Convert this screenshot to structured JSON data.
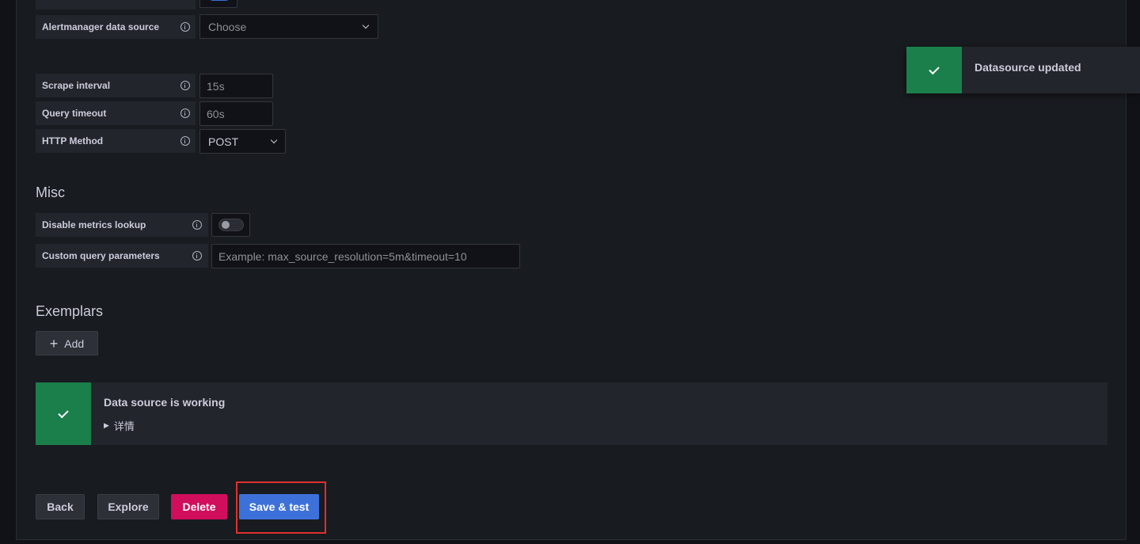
{
  "form": {
    "alertmanager": {
      "label": "Alertmanager data source",
      "placeholder": "Choose"
    },
    "scrape_interval": {
      "label": "Scrape interval",
      "placeholder": "15s"
    },
    "query_timeout": {
      "label": "Query timeout",
      "placeholder": "60s"
    },
    "http_method": {
      "label": "HTTP Method",
      "value": "POST"
    }
  },
  "misc": {
    "title": "Misc",
    "disable_metrics_lookup": {
      "label": "Disable metrics lookup",
      "enabled": false
    },
    "custom_query_params": {
      "label": "Custom query parameters",
      "placeholder": "Example: max_source_resolution=5m&timeout=10"
    }
  },
  "exemplars": {
    "title": "Exemplars",
    "add_label": "Add"
  },
  "status": {
    "title": "Data source is working",
    "details_label": "详情",
    "color": "#1a7f4b"
  },
  "toast": {
    "message": "Datasource updated"
  },
  "actions": {
    "back_label": "Back",
    "explore_label": "Explore",
    "delete_label": "Delete",
    "save_label": "Save & test"
  },
  "colors": {
    "primary": "#3d71d9",
    "danger": "#d10e5c",
    "success": "#1a7f4b",
    "highlight": "#e02f2f"
  }
}
